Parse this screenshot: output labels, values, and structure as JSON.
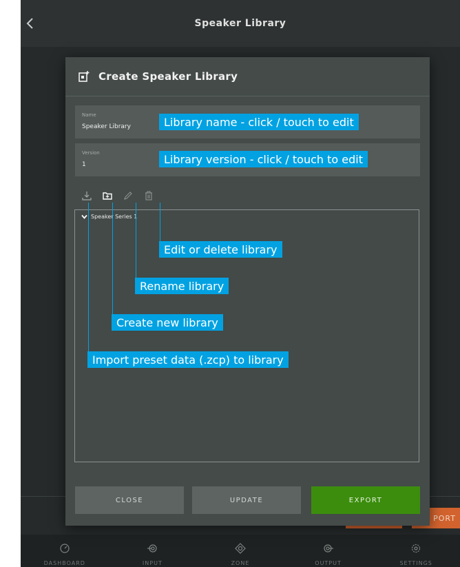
{
  "app": {
    "title": "Speaker Library"
  },
  "underlay": {
    "export_partial": "PORT"
  },
  "navbar": {
    "items": [
      {
        "label": "DASHBOARD",
        "icon": "dashboard-icon"
      },
      {
        "label": "INPUT",
        "icon": "input-icon"
      },
      {
        "label": "ZONE",
        "icon": "zone-icon"
      },
      {
        "label": "OUTPUT",
        "icon": "output-icon"
      },
      {
        "label": "SETTINGS",
        "icon": "settings-icon"
      }
    ]
  },
  "dialog": {
    "title": "Create Speaker Library",
    "name_field": {
      "caption": "Name",
      "value": "Speaker Library"
    },
    "version_field": {
      "caption": "Version",
      "value": "1"
    },
    "toolbar": [
      "import-icon",
      "new-folder-icon",
      "rename-icon",
      "delete-icon"
    ],
    "tree": {
      "item_label": "Speaker Series 1"
    },
    "buttons": {
      "close": "CLOSE",
      "update": "UPDATE",
      "export": "EXPORT"
    }
  },
  "annotations": {
    "name": "Library name - click / touch to edit",
    "version": "Library version - click / touch to edit",
    "edit_delete": "Edit or delete library",
    "rename": "Rename library",
    "create": "Create new library",
    "import": "Import preset data (.zcp) to library"
  },
  "colors": {
    "accent": "#02a2e2",
    "export": "#3c8d0e",
    "underlay_button": "#d2632e"
  }
}
